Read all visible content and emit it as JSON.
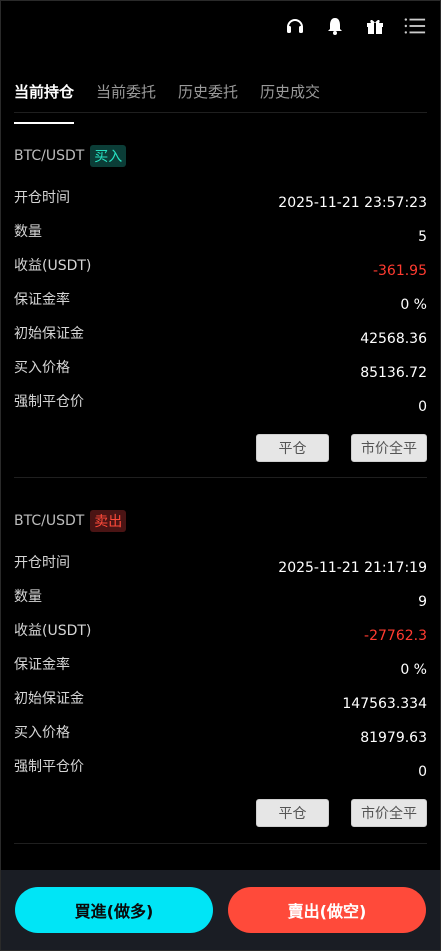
{
  "header": {
    "icons": [
      "headset-icon",
      "bell-icon",
      "gift-icon",
      "menu-icon"
    ]
  },
  "tabs": [
    {
      "label": "当前持仓",
      "active": true
    },
    {
      "label": "当前委托",
      "active": false
    },
    {
      "label": "历史委托",
      "active": false
    },
    {
      "label": "历史成交",
      "active": false
    }
  ],
  "positions": [
    {
      "pair": "BTC/USDT",
      "side": "买入",
      "side_color": "#27e1c1",
      "fields": [
        {
          "label": "开仓时间",
          "value": "2025-11-21 23:57:23"
        },
        {
          "label": "数量",
          "value": "5"
        },
        {
          "label": "收益(USDT)",
          "value": "-361.95"
        },
        {
          "label": "保证金率",
          "value": "0 %"
        },
        {
          "label": "初始保证金",
          "value": "42568.36"
        },
        {
          "label": "买入价格",
          "value": "85136.72"
        },
        {
          "label": "强制平仓价",
          "value": "0"
        }
      ],
      "close_label": "平仓",
      "market_close_label": "市价全平"
    },
    {
      "pair": "BTC/USDT",
      "side": "卖出",
      "side_color": "#ff4a3a",
      "fields": [
        {
          "label": "开仓时间",
          "value": "2025-11-21 21:17:19"
        },
        {
          "label": "数量",
          "value": "9"
        },
        {
          "label": "收益(USDT)",
          "value": "-27762.3"
        },
        {
          "label": "保证金率",
          "value": "0 %"
        },
        {
          "label": "初始保证金",
          "value": "147563.334"
        },
        {
          "label": "买入价格",
          "value": "81979.63"
        },
        {
          "label": "强制平仓价",
          "value": "0"
        }
      ],
      "close_label": "平仓",
      "market_close_label": "市价全平"
    }
  ],
  "footer": {
    "long_label": "買進(做多)",
    "short_label": "賣出(做空)",
    "long_color": "#00e5f6",
    "short_color": "#ff4a3a"
  }
}
